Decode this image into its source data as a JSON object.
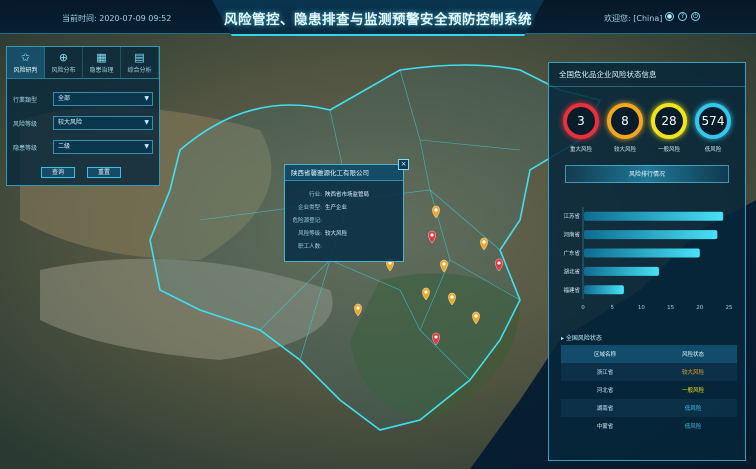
{
  "header": {
    "time_label": "当前时间:",
    "time_value": "2020-07-09  09:52",
    "title": "风险管控、隐患排查与监测预警安全预防控制系统",
    "welcome_label": "欢迎您:",
    "welcome_user": "[China]",
    "icons": [
      "user-icon",
      "help-icon",
      "power-icon"
    ]
  },
  "left_panel": {
    "tabs": [
      {
        "label": "风险研判",
        "icon": "star-icon"
      },
      {
        "label": "风险分布",
        "icon": "globe-icon"
      },
      {
        "label": "隐患治理",
        "icon": "grid-icon"
      },
      {
        "label": "综合分析",
        "icon": "chart-icon"
      }
    ],
    "filters": [
      {
        "label": "行業類型",
        "value": "全部"
      },
      {
        "label": "风险等级",
        "value": "较大风险"
      },
      {
        "label": "隐患等级",
        "value": "二级"
      }
    ],
    "buttons": {
      "query": "查询",
      "reset": "重置"
    }
  },
  "popup": {
    "title": "陕西省馨雅源化工有限公司",
    "close": "×",
    "rows": [
      {
        "k": "行业:",
        "v": "陕西省市场监管局"
      },
      {
        "k": "企业类型:",
        "v": "生产企业"
      },
      {
        "k": "危险源登记:",
        "v": ""
      },
      {
        "k": "风险等级:",
        "v": "较大风险"
      },
      {
        "k": "职工人数:",
        "v": ""
      }
    ]
  },
  "right_panel": {
    "title": "全国危化品企业风险状态信息",
    "circles": [
      {
        "value": "3",
        "label": "重大风险",
        "color": "#e8313a"
      },
      {
        "value": "8",
        "label": "较大风险",
        "color": "#f2a81e"
      },
      {
        "value": "28",
        "label": "一般风险",
        "color": "#f2e41a"
      },
      {
        "value": "574",
        "label": "低风险",
        "color": "#35c6ea"
      }
    ],
    "rank_button": "风险排行情况",
    "status_title": "▸ 全国风险状态",
    "status_headers": [
      "区域名称",
      "风险状态"
    ],
    "status_rows": [
      {
        "area": "浙江省",
        "status": "较大风险",
        "color": "#f2a81e"
      },
      {
        "area": "河北省",
        "status": "一般风险",
        "color": "#f2e41a"
      },
      {
        "area": "湖南省",
        "status": "低风险",
        "color": "#35c6ea"
      },
      {
        "area": "中蒙省",
        "status": "低风险",
        "color": "#35c6ea"
      }
    ]
  },
  "chart_data": {
    "type": "bar",
    "orientation": "horizontal",
    "categories": [
      "江苏省",
      "河南省",
      "广东省",
      "湖北省",
      "福建省"
    ],
    "values": [
      24,
      23,
      20,
      13,
      7
    ],
    "xlim": [
      0,
      25
    ],
    "xticks": [
      0,
      5,
      10,
      15,
      20,
      25
    ],
    "color": "#3fd2f0"
  },
  "map": {
    "markers": [
      {
        "color": "#f2a81e"
      },
      {
        "color": "#e8313a"
      },
      {
        "color": "#f2a81e"
      },
      {
        "color": "#f2a81e"
      },
      {
        "color": "#f2a81e"
      },
      {
        "color": "#e8313a"
      },
      {
        "color": "#f2a81e"
      },
      {
        "color": "#f2a81e"
      },
      {
        "color": "#f2a81e"
      },
      {
        "color": "#f2a81e"
      },
      {
        "color": "#e8313a"
      }
    ]
  }
}
